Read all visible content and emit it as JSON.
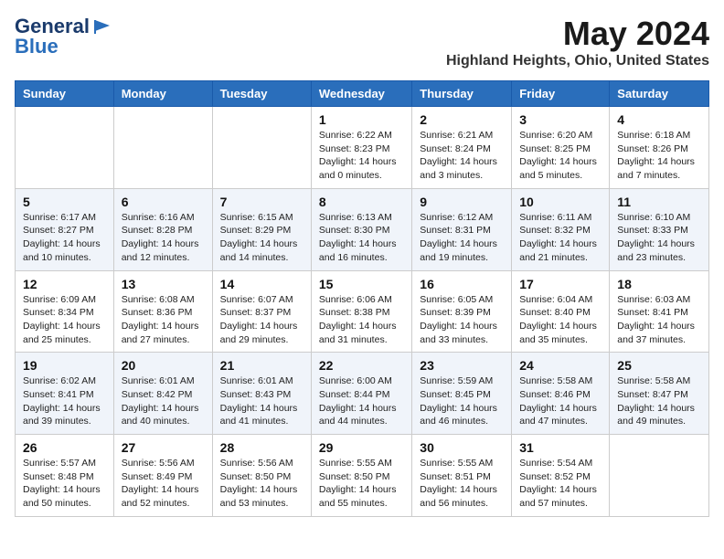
{
  "header": {
    "logo_line1": "General",
    "logo_line2": "Blue",
    "month_year": "May 2024",
    "location": "Highland Heights, Ohio, United States"
  },
  "days_of_week": [
    "Sunday",
    "Monday",
    "Tuesday",
    "Wednesday",
    "Thursday",
    "Friday",
    "Saturday"
  ],
  "weeks": [
    [
      {
        "day": "",
        "info": ""
      },
      {
        "day": "",
        "info": ""
      },
      {
        "day": "",
        "info": ""
      },
      {
        "day": "1",
        "info": "Sunrise: 6:22 AM\nSunset: 8:23 PM\nDaylight: 14 hours\nand 0 minutes."
      },
      {
        "day": "2",
        "info": "Sunrise: 6:21 AM\nSunset: 8:24 PM\nDaylight: 14 hours\nand 3 minutes."
      },
      {
        "day": "3",
        "info": "Sunrise: 6:20 AM\nSunset: 8:25 PM\nDaylight: 14 hours\nand 5 minutes."
      },
      {
        "day": "4",
        "info": "Sunrise: 6:18 AM\nSunset: 8:26 PM\nDaylight: 14 hours\nand 7 minutes."
      }
    ],
    [
      {
        "day": "5",
        "info": "Sunrise: 6:17 AM\nSunset: 8:27 PM\nDaylight: 14 hours\nand 10 minutes."
      },
      {
        "day": "6",
        "info": "Sunrise: 6:16 AM\nSunset: 8:28 PM\nDaylight: 14 hours\nand 12 minutes."
      },
      {
        "day": "7",
        "info": "Sunrise: 6:15 AM\nSunset: 8:29 PM\nDaylight: 14 hours\nand 14 minutes."
      },
      {
        "day": "8",
        "info": "Sunrise: 6:13 AM\nSunset: 8:30 PM\nDaylight: 14 hours\nand 16 minutes."
      },
      {
        "day": "9",
        "info": "Sunrise: 6:12 AM\nSunset: 8:31 PM\nDaylight: 14 hours\nand 19 minutes."
      },
      {
        "day": "10",
        "info": "Sunrise: 6:11 AM\nSunset: 8:32 PM\nDaylight: 14 hours\nand 21 minutes."
      },
      {
        "day": "11",
        "info": "Sunrise: 6:10 AM\nSunset: 8:33 PM\nDaylight: 14 hours\nand 23 minutes."
      }
    ],
    [
      {
        "day": "12",
        "info": "Sunrise: 6:09 AM\nSunset: 8:34 PM\nDaylight: 14 hours\nand 25 minutes."
      },
      {
        "day": "13",
        "info": "Sunrise: 6:08 AM\nSunset: 8:36 PM\nDaylight: 14 hours\nand 27 minutes."
      },
      {
        "day": "14",
        "info": "Sunrise: 6:07 AM\nSunset: 8:37 PM\nDaylight: 14 hours\nand 29 minutes."
      },
      {
        "day": "15",
        "info": "Sunrise: 6:06 AM\nSunset: 8:38 PM\nDaylight: 14 hours\nand 31 minutes."
      },
      {
        "day": "16",
        "info": "Sunrise: 6:05 AM\nSunset: 8:39 PM\nDaylight: 14 hours\nand 33 minutes."
      },
      {
        "day": "17",
        "info": "Sunrise: 6:04 AM\nSunset: 8:40 PM\nDaylight: 14 hours\nand 35 minutes."
      },
      {
        "day": "18",
        "info": "Sunrise: 6:03 AM\nSunset: 8:41 PM\nDaylight: 14 hours\nand 37 minutes."
      }
    ],
    [
      {
        "day": "19",
        "info": "Sunrise: 6:02 AM\nSunset: 8:41 PM\nDaylight: 14 hours\nand 39 minutes."
      },
      {
        "day": "20",
        "info": "Sunrise: 6:01 AM\nSunset: 8:42 PM\nDaylight: 14 hours\nand 40 minutes."
      },
      {
        "day": "21",
        "info": "Sunrise: 6:01 AM\nSunset: 8:43 PM\nDaylight: 14 hours\nand 41 minutes."
      },
      {
        "day": "22",
        "info": "Sunrise: 6:00 AM\nSunset: 8:44 PM\nDaylight: 14 hours\nand 44 minutes."
      },
      {
        "day": "23",
        "info": "Sunrise: 5:59 AM\nSunset: 8:45 PM\nDaylight: 14 hours\nand 46 minutes."
      },
      {
        "day": "24",
        "info": "Sunrise: 5:58 AM\nSunset: 8:46 PM\nDaylight: 14 hours\nand 47 minutes."
      },
      {
        "day": "25",
        "info": "Sunrise: 5:58 AM\nSunset: 8:47 PM\nDaylight: 14 hours\nand 49 minutes."
      }
    ],
    [
      {
        "day": "26",
        "info": "Sunrise: 5:57 AM\nSunset: 8:48 PM\nDaylight: 14 hours\nand 50 minutes."
      },
      {
        "day": "27",
        "info": "Sunrise: 5:56 AM\nSunset: 8:49 PM\nDaylight: 14 hours\nand 52 minutes."
      },
      {
        "day": "28",
        "info": "Sunrise: 5:56 AM\nSunset: 8:50 PM\nDaylight: 14 hours\nand 53 minutes."
      },
      {
        "day": "29",
        "info": "Sunrise: 5:55 AM\nSunset: 8:50 PM\nDaylight: 14 hours\nand 55 minutes."
      },
      {
        "day": "30",
        "info": "Sunrise: 5:55 AM\nSunset: 8:51 PM\nDaylight: 14 hours\nand 56 minutes."
      },
      {
        "day": "31",
        "info": "Sunrise: 5:54 AM\nSunset: 8:52 PM\nDaylight: 14 hours\nand 57 minutes."
      },
      {
        "day": "",
        "info": ""
      }
    ]
  ]
}
